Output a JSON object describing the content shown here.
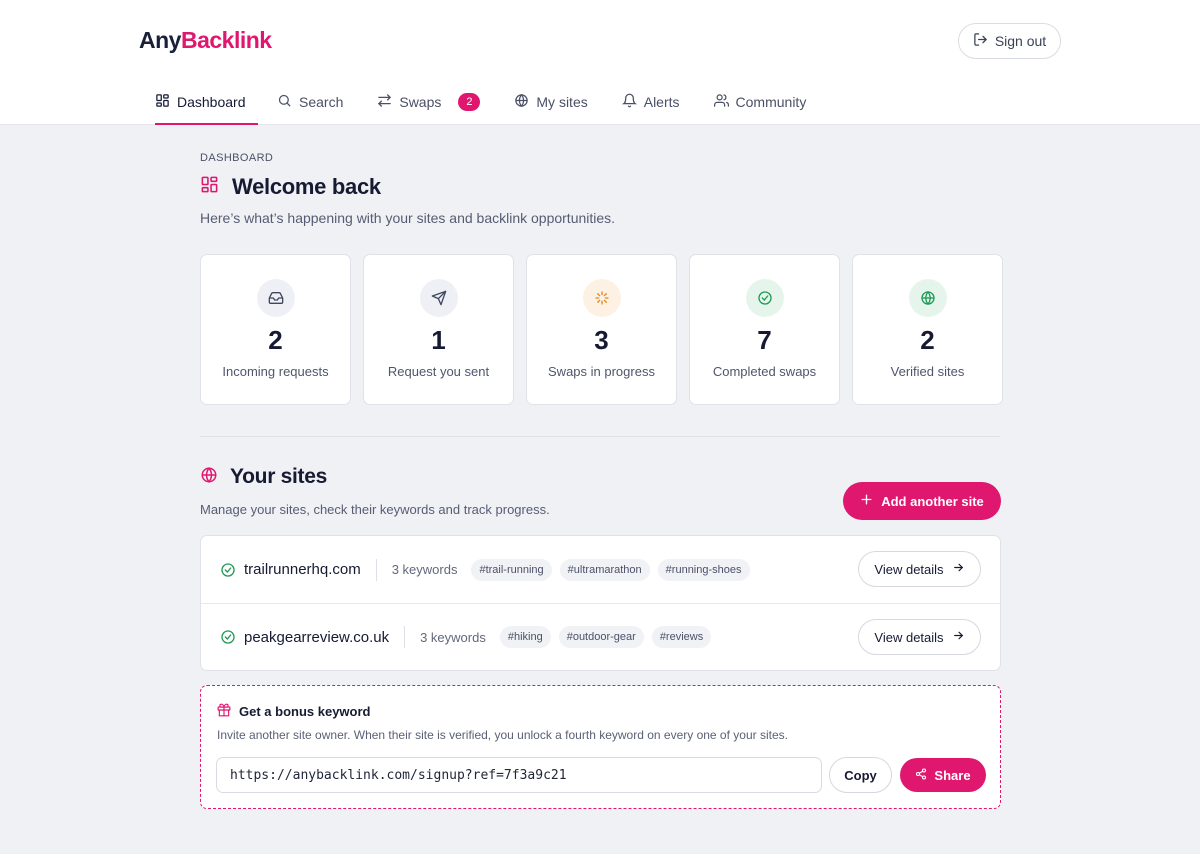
{
  "brand": {
    "part1": "Any",
    "part2": "Backlink"
  },
  "header": {
    "signout_label": "Sign out"
  },
  "nav": {
    "items": [
      {
        "label": "Dashboard",
        "icon": "grid-icon",
        "active": true
      },
      {
        "label": "Search",
        "icon": "search-icon"
      },
      {
        "label": "Swaps",
        "icon": "swap-icon",
        "badge": "2"
      },
      {
        "label": "My sites",
        "icon": "globe-icon"
      },
      {
        "label": "Alerts",
        "icon": "bell-icon"
      },
      {
        "label": "Community",
        "icon": "users-icon"
      }
    ]
  },
  "page": {
    "breadcrumb": "DASHBOARD",
    "title": "Welcome back",
    "subtitle": "Here’s what’s happening with your sites and backlink opportunities."
  },
  "stats": [
    {
      "value": "2",
      "label": "Incoming requests",
      "icon": "inbox-icon"
    },
    {
      "value": "1",
      "label": "Request you sent",
      "icon": "send-icon"
    },
    {
      "value": "3",
      "label": "Swaps in progress",
      "icon": "loader-icon"
    },
    {
      "value": "7",
      "label": "Completed swaps",
      "icon": "check-circle-icon"
    },
    {
      "value": "2",
      "label": "Verified sites",
      "icon": "globe-icon"
    }
  ],
  "sites": {
    "title": "Your sites",
    "subtitle": "Manage your sites, check their keywords and track progress.",
    "add_label": "Add another site",
    "rows": [
      {
        "domain": "trailrunnerhq.com",
        "keywords": "3 keywords",
        "tags": [
          "#trail-running",
          "#ultramarathon",
          "#running-shoes"
        ],
        "action": "View details"
      },
      {
        "domain": "peakgearreview.co.uk",
        "keywords": "3 keywords",
        "tags": [
          "#hiking",
          "#outdoor-gear",
          "#reviews"
        ],
        "action": "View details"
      }
    ]
  },
  "bonus": {
    "title": "Get a bonus keyword",
    "description": "Invite another site owner. When their site is verified, you unlock a fourth keyword on every one of your sites.",
    "url": "https://anybacklink.com/signup?ref=7f3a9c21",
    "copy_label": "Copy",
    "share_label": "Share"
  },
  "colors": {
    "accent": "#e0176f",
    "text": "#161a33",
    "bg": "#f0f1f5"
  }
}
